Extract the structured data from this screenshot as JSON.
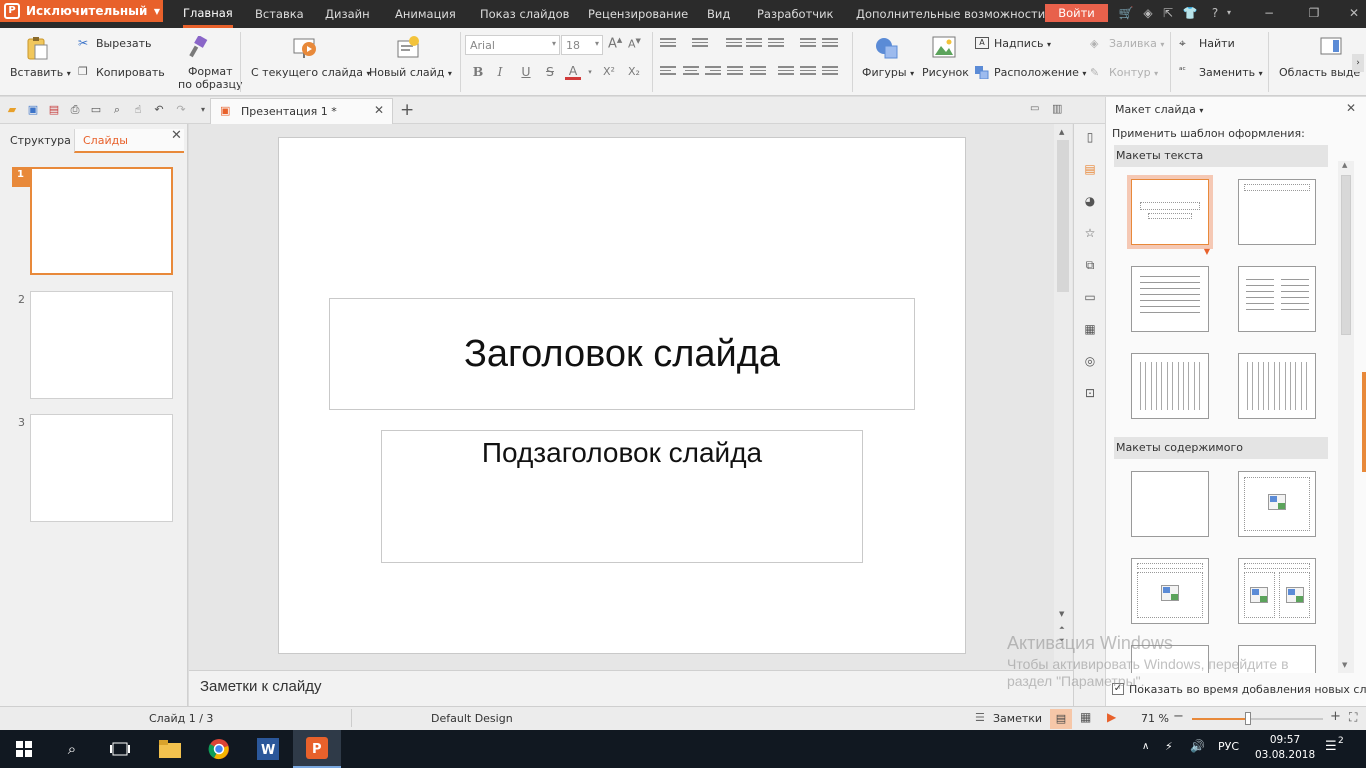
{
  "app": {
    "brand_label": "Исключительный",
    "menu_tabs": [
      "Главная",
      "Вставка",
      "Дизайн",
      "Анимация",
      "Показ слайдов",
      "Рецензирование",
      "Вид",
      "Разработчик",
      "Дополнительные возможности"
    ],
    "login_label": "Войти",
    "accent_color": "#e8612b"
  },
  "ribbon": {
    "paste": "Вставить",
    "cut": "Вырезать",
    "copy": "Копировать",
    "format_painter_1": "Формат",
    "format_painter_2": "по образцу",
    "from_current_slide": "С текущего слайда",
    "new_slide": "Новый слайд",
    "font_name": "Arial",
    "font_size": "18",
    "bold": "B",
    "italic": "I",
    "underline": "U",
    "strike": "S",
    "font_color": "A",
    "superscript": "X²",
    "subscript": "X₂",
    "grow_font": "A",
    "shrink_font": "A",
    "shapes": "Фигуры",
    "picture": "Рисунок",
    "textbox": "Надпись",
    "arrange": "Расположение",
    "fill": "Заливка",
    "outline": "Контур",
    "find": "Найти",
    "replace": "Заменить",
    "select_area": "Область выде"
  },
  "document": {
    "tab_title": "Презентация 1 *"
  },
  "left_pane": {
    "tab_outline": "Структура",
    "tab_slides": "Слайды",
    "slide_numbers": [
      "1",
      "2",
      "3"
    ]
  },
  "slide": {
    "title": "Заголовок слайда",
    "subtitle": "Подзаголовок слайда"
  },
  "notes_placeholder": "Заметки к слайду",
  "right_panel": {
    "title": "Макет слайда",
    "apply_template": "Применить шаблон оформления:",
    "section_text": "Макеты текста",
    "section_content": "Макеты содержимого",
    "show_when_adding": "Показать во время добавления новых сла"
  },
  "statusbar": {
    "slide_counter": "Слайд 1 / 3",
    "design_name": "Default Design",
    "notes_label": "Заметки",
    "zoom": "71 %",
    "zoom_fraction": 0.71
  },
  "watermark": {
    "line1": "Активация Windows",
    "line2": "Чтобы активировать Windows, перейдите в",
    "line3": "раздел \"Параметры\"."
  },
  "taskbar": {
    "language": "РУС",
    "time": "09:57",
    "date": "03.08.2018",
    "notifications": "2"
  }
}
